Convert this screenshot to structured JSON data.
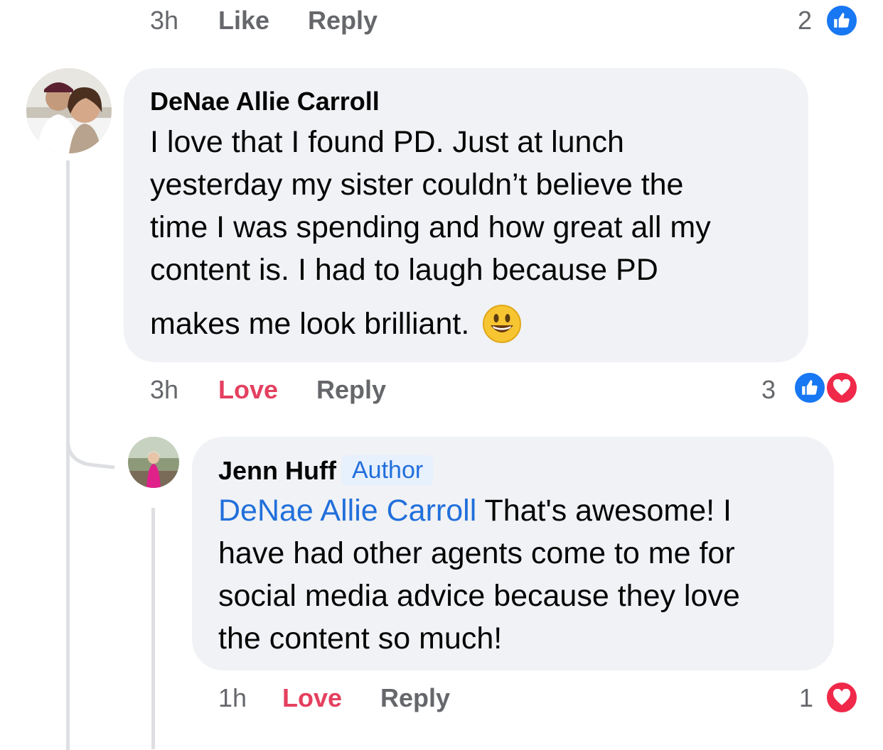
{
  "top_row": {
    "time": "3h",
    "like_label": "Like",
    "reply_label": "Reply",
    "reaction_count": "2",
    "reactions": [
      "like-icon"
    ]
  },
  "comment1": {
    "author": "DeNae Allie Carroll",
    "lines": [
      "I love that I found PD. Just at lunch",
      "yesterday my sister couldn’t believe the",
      "time I was spending and how great all my",
      "content is. I had to laugh because PD",
      "makes me look brilliant."
    ],
    "emoji": "smiling-face-emoji",
    "time": "3h",
    "love_label": "Love",
    "reply_label": "Reply",
    "reaction_count": "3",
    "reactions": [
      "like-icon",
      "heart-icon"
    ]
  },
  "comment2": {
    "author": "Jenn Huff",
    "badge": "Author",
    "mention": "DeNae Allie Carroll",
    "lines": [
      "That's awesome! I",
      "have had other agents come to me for",
      "social media advice because they love",
      "the content so much!"
    ],
    "time": "1h",
    "love_label": "Love",
    "reply_label": "Reply",
    "reaction_count": "1",
    "reactions": [
      "heart-icon"
    ]
  },
  "colors": {
    "bubble": "#f0f2f5",
    "meta_gray": "#65676b",
    "love_red": "#e4405f",
    "mention_blue": "#216fdb",
    "like_blue": "#1877f2",
    "heart_red": "#f02849"
  }
}
